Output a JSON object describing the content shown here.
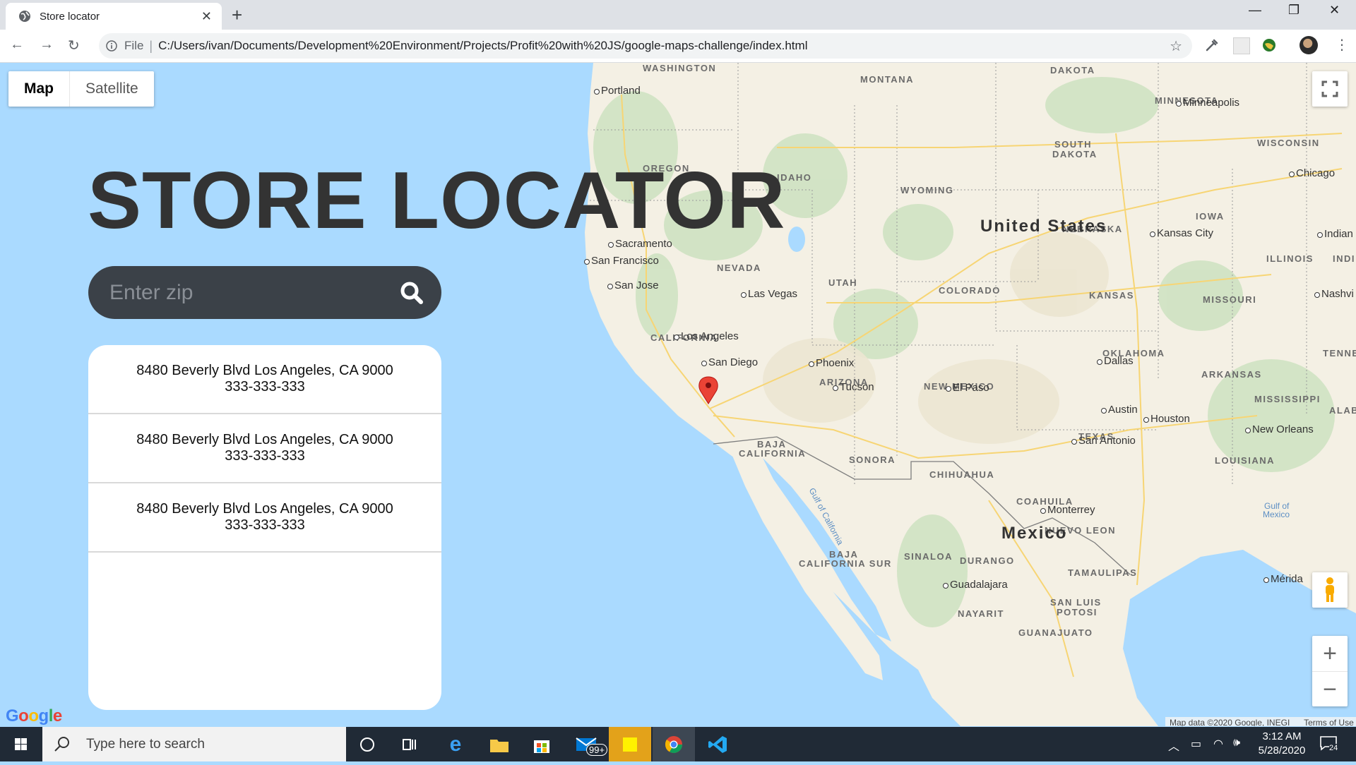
{
  "browser": {
    "tab_title": "Store locator",
    "url_scheme": "File",
    "url": "C:/Users/ivan/Documents/Development%20Environment/Projects/Profit%20with%20JS/google-maps-challenge/index.html"
  },
  "page": {
    "title": "STORE LOCATOR",
    "search_placeholder": "Enter zip",
    "stores": [
      {
        "address": "8480 Beverly Blvd Los Angeles, CA 9000",
        "phone": "333-333-333"
      },
      {
        "address": "8480 Beverly Blvd Los Angeles, CA 9000",
        "phone": "333-333-333"
      },
      {
        "address": "8480 Beverly Blvd Los Angeles, CA 9000",
        "phone": "333-333-333"
      }
    ]
  },
  "map": {
    "map_type_map": "Map",
    "map_type_satellite": "Satellite",
    "attribution": "Map data ©2020 Google, INEGI",
    "terms": "Terms of Use",
    "logo": "Google",
    "regions": {
      "washington": "WASHINGTON",
      "montana": "MONTANA",
      "dakota": "DAKOTA",
      "minnesota": "MINNESOTA",
      "oregon": "OREGON",
      "idaho": "IDAHO",
      "south_dakota_1": "SOUTH",
      "south_dakota_2": "DAKOTA",
      "wisconsin": "WISCONSIN",
      "wyoming": "WYOMING",
      "iowa": "IOWA",
      "nebraska": "NEBRASKA",
      "illinois": "ILLINOIS",
      "indiana": "INDI",
      "nevada": "NEVADA",
      "utah": "UTAH",
      "colorado": "COLORADO",
      "kansas": "KANSAS",
      "missouri": "MISSOURI",
      "california": "CALIFORNIA",
      "oklahoma": "OKLAHOMA",
      "tennessee": "TENNES",
      "arkansas": "ARKANSAS",
      "arizona": "ARIZONA",
      "new_mexico": "NEW MEXICO",
      "mississippi": "MISSISSIPPI",
      "alabama": "ALABA",
      "texas": "TEXAS",
      "louisiana": "LOUISIANA",
      "baja_california_1": "BAJA",
      "baja_california_2": "CALIFORNIA",
      "sonora": "SONORA",
      "chihuahua": "CHIHUAHUA",
      "coahuila": "COAHUILA",
      "nuevo_leon": "NUEVO LEON",
      "baja_sur_1": "BAJA",
      "baja_sur_2": "CALIFORNIA SUR",
      "sinaloa": "SINALOA",
      "durango": "DURANGO",
      "tamaulipas": "TAMAULIPAS",
      "nayarit": "NAYARIT",
      "san_luis_1": "SAN LUIS",
      "san_luis_2": "POTOSI",
      "guanajuato": "GUANAJUATO"
    },
    "countries": {
      "usa": "United States",
      "mexico": "Mexico"
    },
    "cities": {
      "portland": "Portland",
      "minneapolis": "Minneapolis",
      "chicago": "Chicago",
      "sacramento": "Sacramento",
      "san_francisco": "San Francisco",
      "san_jose": "San Jose",
      "kansas_city": "Kansas City",
      "indianapolis": "Indian",
      "las_vegas": "Las Vegas",
      "nashville": "Nashvi",
      "los_angeles": "Los Angeles",
      "phoenix": "Phoenix",
      "san_diego": "San Diego",
      "dallas": "Dallas",
      "tucson": "Tucson",
      "el_paso": "El Paso",
      "austin": "Austin",
      "houston": "Houston",
      "new_orleans": "New Orleans",
      "san_antonio": "San Antonio",
      "monterrey": "Monterrey",
      "guadalajara": "Guadalajara",
      "merida": "Mérida"
    },
    "water": {
      "gulf_california": "Gulf of California",
      "gulf_mexico_1": "Gulf of",
      "gulf_mexico_2": "Mexico"
    }
  },
  "taskbar": {
    "search_placeholder": "Type here to search",
    "mail_badge": "99+",
    "time": "3:12 AM",
    "date": "5/28/2020",
    "notifications": "24"
  },
  "colors": {
    "ocean": "#aadaff",
    "land": "#f5f1e6",
    "title": "#333333",
    "search_bg": "#3b4148",
    "marker": "#ea4335"
  }
}
